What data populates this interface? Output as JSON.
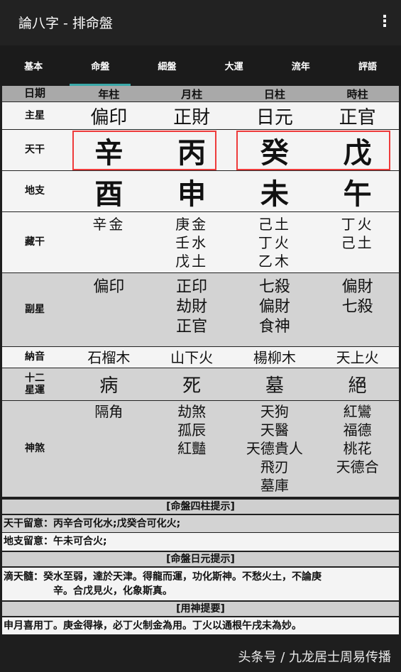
{
  "app": {
    "title": "論八字 - 排命盤"
  },
  "tabs": [
    "基本",
    "命盤",
    "細盤",
    "大運",
    "流年",
    "評語"
  ],
  "header": {
    "label": "日期",
    "cols": [
      "年柱",
      "月柱",
      "日柱",
      "時柱"
    ]
  },
  "rows": {
    "zhuxing": {
      "label": "主星",
      "values": [
        "偏印",
        "正財",
        "日元",
        "正官"
      ]
    },
    "tiangan": {
      "label": "天干",
      "values": [
        "辛",
        "丙",
        "癸",
        "戊"
      ]
    },
    "dizhi": {
      "label": "地支",
      "values": [
        "酉",
        "申",
        "未",
        "午"
      ]
    },
    "canggan": {
      "label": "藏干",
      "values": [
        [
          "辛金"
        ],
        [
          "庚金",
          "壬水",
          "戊土"
        ],
        [
          "己土",
          "丁火",
          "乙木"
        ],
        [
          "丁火",
          "己土"
        ]
      ]
    },
    "fuxing": {
      "label": "副星",
      "values": [
        [
          "偏印"
        ],
        [
          "正印",
          "劫財",
          "正官"
        ],
        [
          "七殺",
          "偏財",
          "食神"
        ],
        [
          "偏財",
          "七殺"
        ]
      ]
    },
    "nayin": {
      "label": "納音",
      "values": [
        "石榴木",
        "山下火",
        "楊柳木",
        "天上火"
      ]
    },
    "xingyun": {
      "label": "十二星運",
      "values": [
        "病",
        "死",
        "墓",
        "絕"
      ]
    },
    "shensha": {
      "label": "神煞",
      "values": [
        [
          "隔角"
        ],
        [
          "劫煞",
          "孤辰",
          "紅豔"
        ],
        [
          "天狗",
          "天醫",
          "天德貴人",
          "飛刃",
          "墓庫"
        ],
        [
          "紅鸞",
          "福德",
          "桃花",
          "天德合"
        ]
      ]
    }
  },
  "colors": {
    "tiangan": [
      "#ff8c00",
      "#ee0000",
      "#1010cc",
      "#a55a00"
    ],
    "dizhi": [
      "#ff8c00",
      "#ff8c00",
      "#a55a00",
      "#ee0000"
    ],
    "rizhu": "#ee1111"
  },
  "sections": {
    "sizhu_title": "[命盤四柱提示]",
    "tiangan_hint": "天干留意：丙辛合可化水;戊癸合可化火;",
    "dizhi_hint": "地支留意：午未可合火;",
    "riyuan_title": "[命盤日元提示]",
    "ditiansui_1": "滴天髓：癸水至弱，達於天津。得龍而運，功化斯神。不愁火土，不論庚",
    "ditiansui_2": "辛。合戊見火，化象斯真。",
    "yongshen_title": "[用神提要]",
    "yongshen": "申月喜用丁。庚金得祿，必丁火制金為用。丁火以通根午戌未為妙。"
  },
  "footer": {
    "watermark": "头条号 / 九龙居士周易传播"
  }
}
